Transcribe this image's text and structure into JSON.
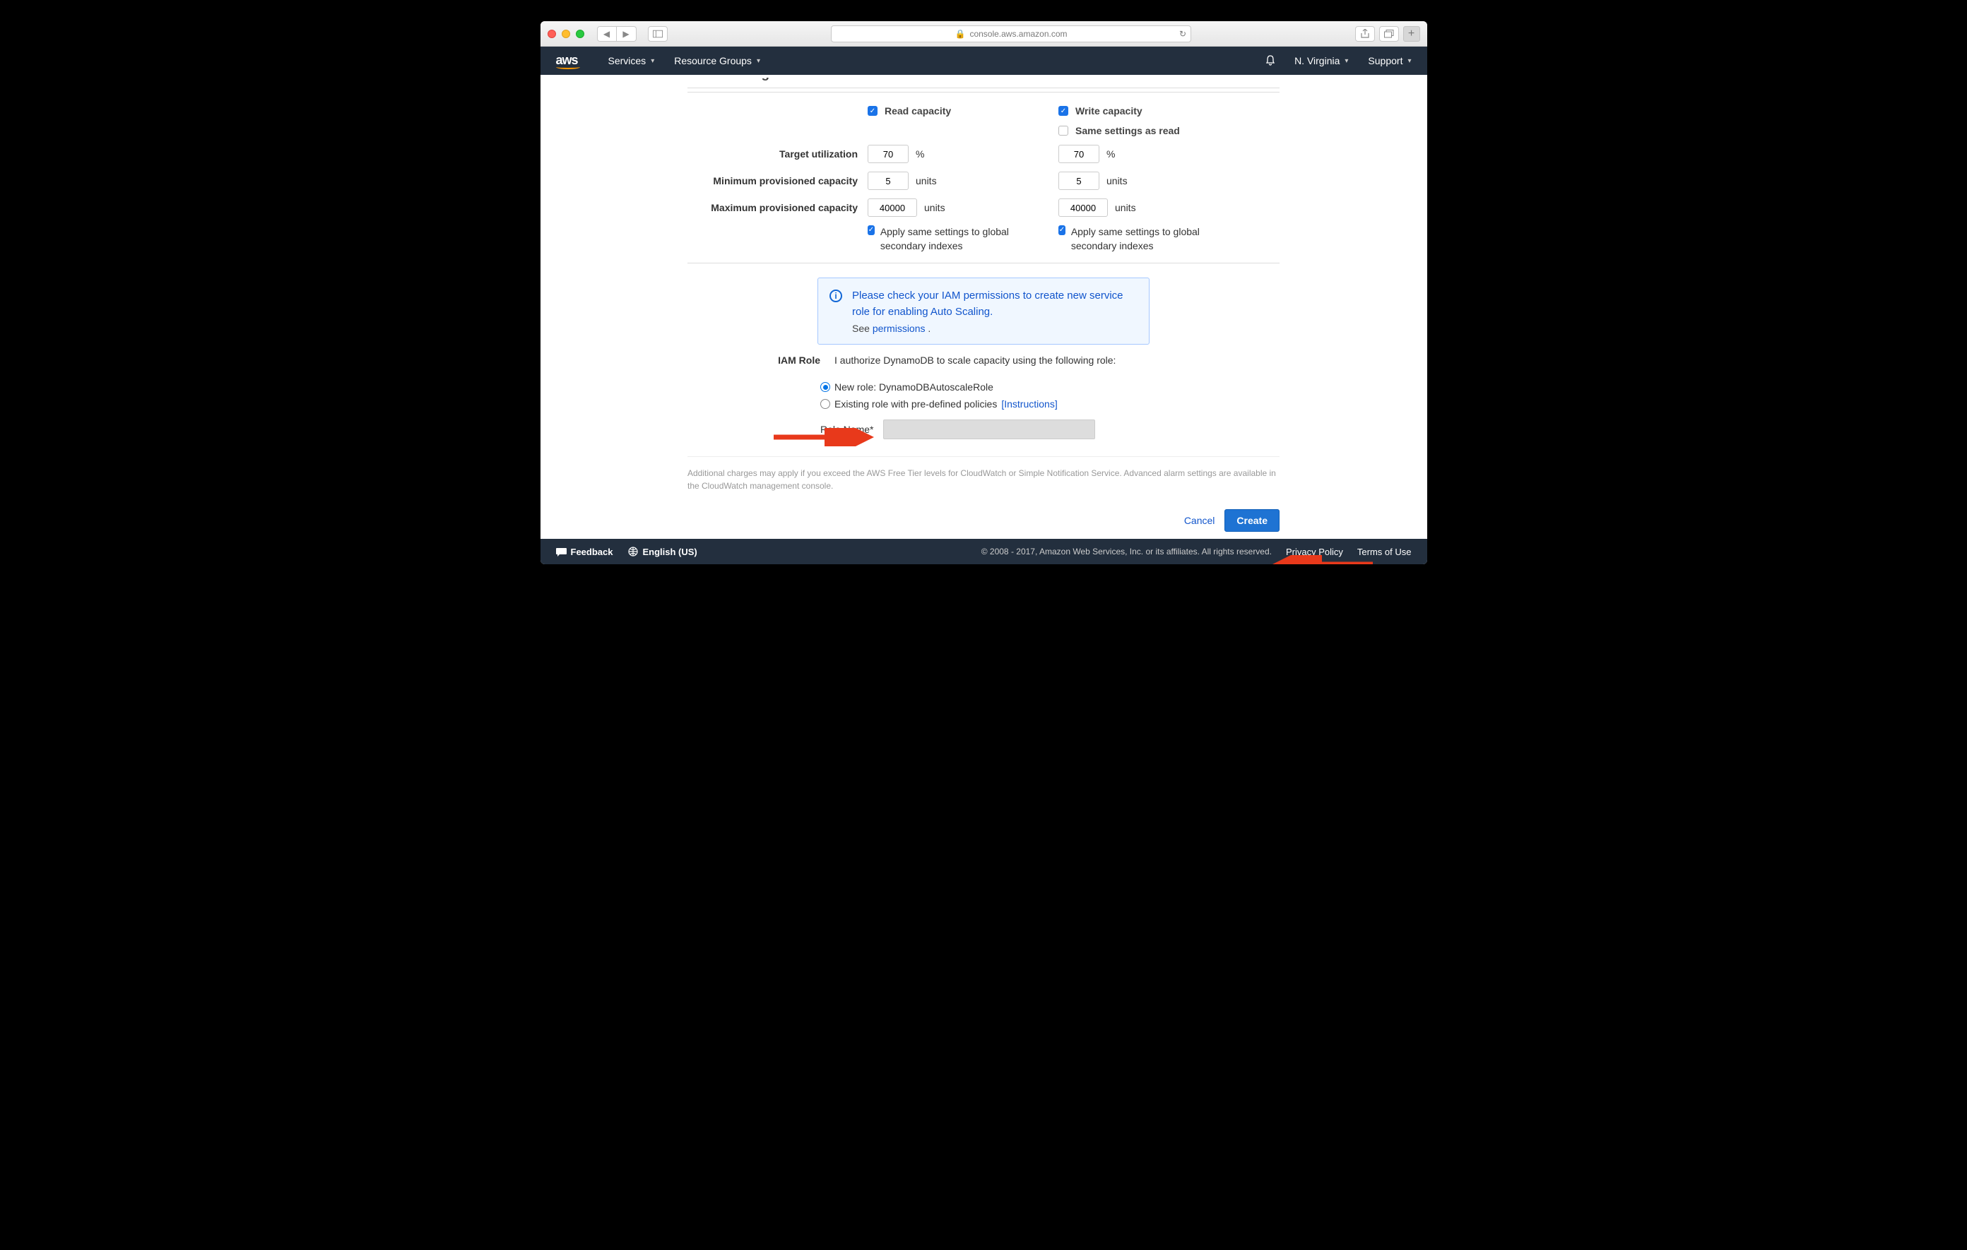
{
  "browser": {
    "url": "console.aws.amazon.com"
  },
  "nav": {
    "logo": "aws",
    "services": "Services",
    "resource_groups": "Resource Groups",
    "region": "N. Virginia",
    "support": "Support"
  },
  "section": {
    "title": "Auto Scaling"
  },
  "capacity": {
    "read_label": "Read capacity",
    "write_label": "Write capacity",
    "same_settings": "Same settings as read",
    "rows": {
      "target": {
        "label": "Target utilization",
        "read": "70",
        "write": "70",
        "unit": "%"
      },
      "min": {
        "label": "Minimum provisioned capacity",
        "read": "5",
        "write": "5",
        "unit": "units"
      },
      "max": {
        "label": "Maximum provisioned capacity",
        "read": "40000",
        "write": "40000",
        "unit": "units"
      }
    },
    "apply_same": "Apply same settings to global secondary indexes"
  },
  "info": {
    "text": "Please check your IAM permissions to create new service role for enabling Auto Scaling.",
    "see": "See",
    "permissions": "permissions"
  },
  "iam": {
    "label": "IAM Role",
    "desc": "I authorize DynamoDB to scale capacity using the following role:",
    "new_role": "New role: DynamoDBAutoscaleRole",
    "existing_role": "Existing role with pre-defined policies",
    "instructions": "[Instructions]",
    "role_name_label": "Role Name*"
  },
  "charges": "Additional charges may apply if you exceed the AWS Free Tier levels for CloudWatch or Simple Notification Service. Advanced alarm settings are available in the CloudWatch management console.",
  "actions": {
    "cancel": "Cancel",
    "create": "Create"
  },
  "footer": {
    "feedback": "Feedback",
    "language": "English (US)",
    "copyright": "© 2008 - 2017, Amazon Web Services, Inc. or its affiliates. All rights reserved.",
    "privacy": "Privacy Policy",
    "terms": "Terms of Use"
  }
}
